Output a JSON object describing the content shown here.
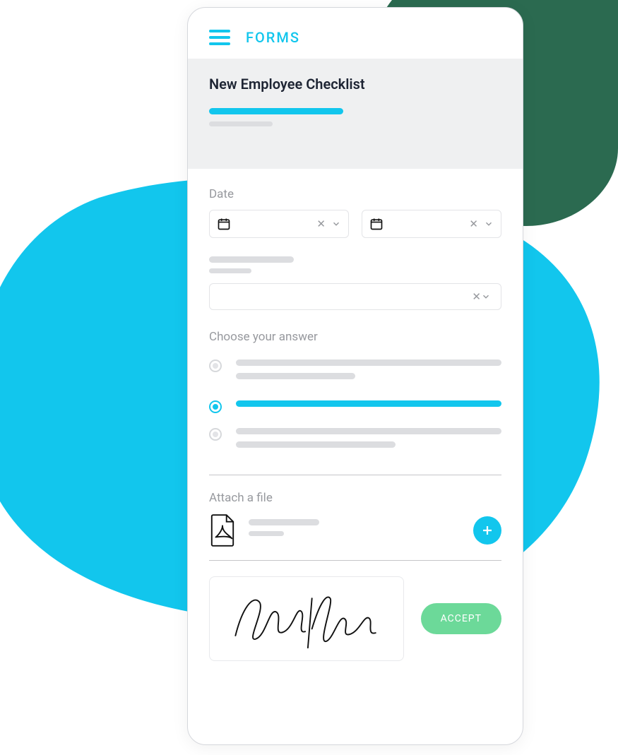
{
  "header": {
    "brand": "FORMS"
  },
  "banner": {
    "title": "New Employee Checklist"
  },
  "form": {
    "date_label": "Date",
    "choose_label": "Choose your answer",
    "attach_label": "Attach a file",
    "accept_label": "ACCEPT"
  }
}
